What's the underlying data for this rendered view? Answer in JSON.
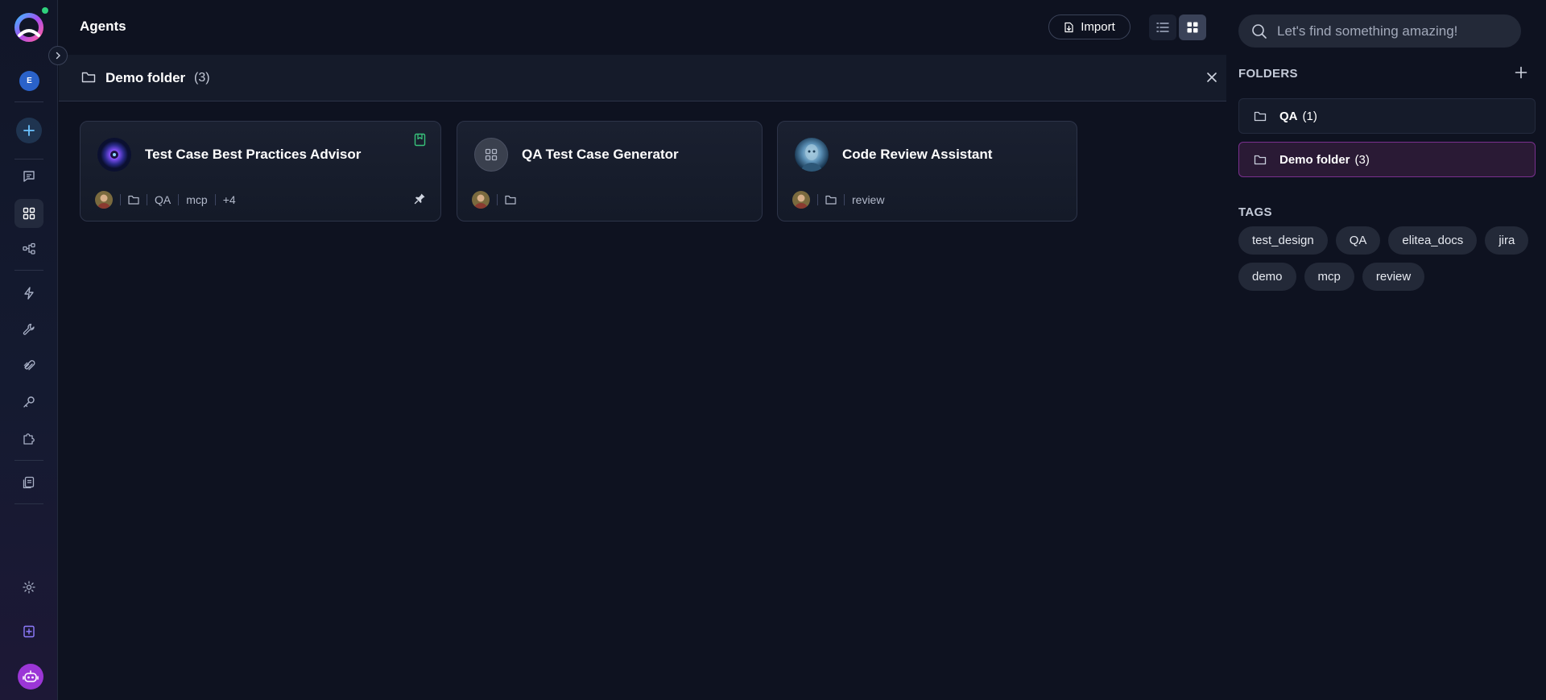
{
  "header": {
    "title": "Agents",
    "import_label": "Import"
  },
  "folder_bar": {
    "name": "Demo folder",
    "count": "(3)"
  },
  "cards": [
    {
      "title": "Test Case Best Practices Advisor",
      "tags": [
        "QA",
        "mcp"
      ],
      "more": "+4"
    },
    {
      "title": "QA Test Case Generator"
    },
    {
      "title": "Code Review Assistant",
      "tags": [
        "review"
      ]
    }
  ],
  "search": {
    "placeholder": "Let's find something amazing!"
  },
  "folders_section": {
    "title": "FOLDERS",
    "items": [
      {
        "name": "QA",
        "count": "(1)"
      },
      {
        "name": "Demo folder",
        "count": "(3)"
      }
    ]
  },
  "tags_section": {
    "title": "TAGS",
    "items": [
      "test_design",
      "QA",
      "elitea_docs",
      "jira",
      "demo",
      "mcp",
      "review"
    ]
  },
  "sidebar": {
    "user_initial": "E",
    "nav": [
      "chat-icon",
      "agents-icon",
      "pipelines-icon",
      "flash-icon",
      "wrench-icon",
      "paperclip-icon",
      "key-icon",
      "puzzle-icon",
      "documents-icon",
      "settings-icon",
      "add-note-icon"
    ]
  },
  "colors": {
    "accent": "#9b36d6",
    "active_folder_border": "#7a2f8e",
    "online": "#2fd17d",
    "bookmark": "#38c27a"
  }
}
